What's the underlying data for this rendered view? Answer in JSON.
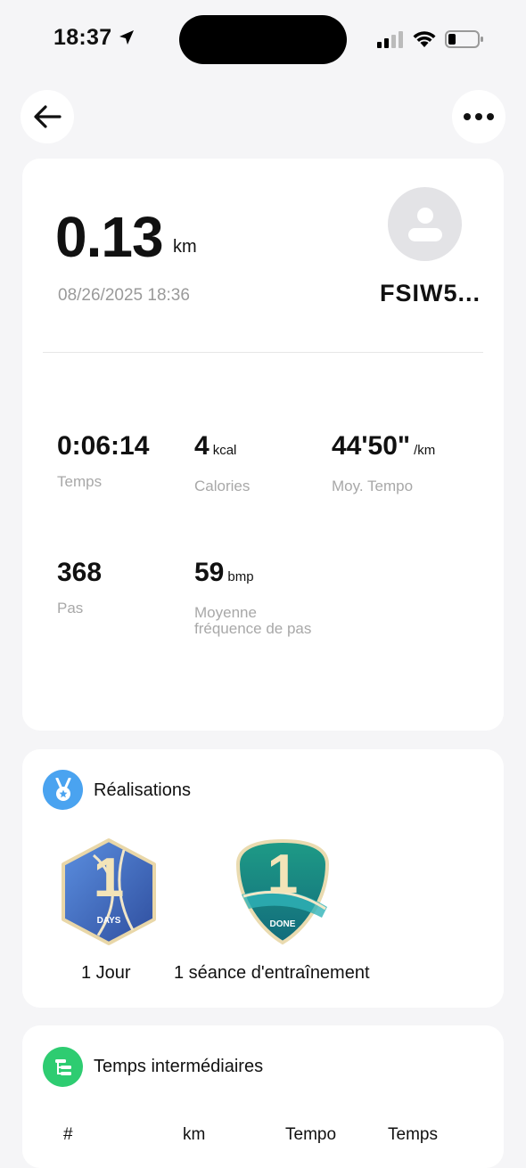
{
  "status_bar": {
    "time": "18:37",
    "icons": [
      "location-arrow-icon",
      "cellular-signal-icon",
      "wifi-icon",
      "battery-icon"
    ]
  },
  "nav": {
    "back_icon": "arrow-left-icon",
    "more_icon": "ellipsis-icon"
  },
  "summary": {
    "distance": "0.13",
    "distance_unit": "km",
    "datetime": "08/26/2025 18:36",
    "username": "FSIW5..."
  },
  "stats": [
    {
      "value": "0:06:14",
      "unit": "",
      "label": "Temps"
    },
    {
      "value": "4",
      "unit": "kcal",
      "label": "Calories"
    },
    {
      "value": "44'50\"",
      "unit": "/km",
      "label": "Moy. Tempo"
    },
    {
      "value": "368",
      "unit": "",
      "label": "Pas"
    },
    {
      "value": "59",
      "unit": "bmp",
      "label_line1": "Moyenne",
      "label_line2": "fréquence de pas"
    }
  ],
  "achievements": {
    "title": "Réalisations",
    "icon": "medal-icon",
    "accent": "#4aa3f0",
    "badges": [
      {
        "number": "1",
        "caption": "DAYS",
        "label": "1 Jour"
      },
      {
        "number": "1",
        "caption": "DONE",
        "label": "1 séance d'entraînement"
      }
    ]
  },
  "splits": {
    "title": "Temps intermédiaires",
    "icon": "splits-list-icon",
    "accent": "#2ecc71",
    "columns": [
      "#",
      "km",
      "Tempo",
      "Temps"
    ]
  }
}
